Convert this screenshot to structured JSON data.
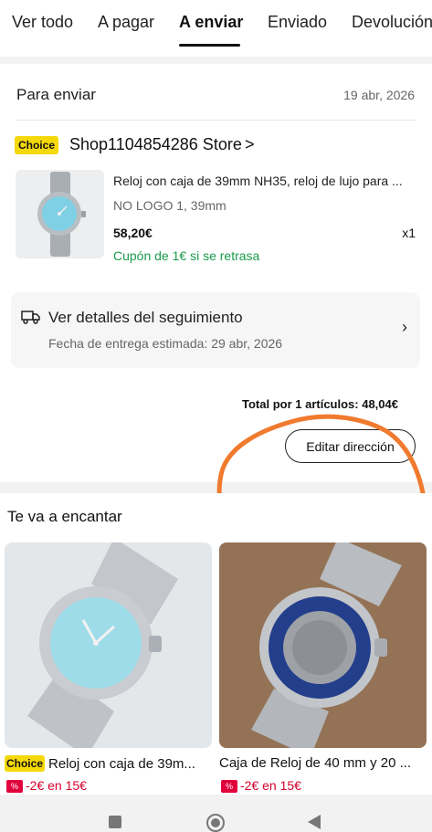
{
  "tabs": [
    {
      "label": "Ver todo"
    },
    {
      "label": "A pagar"
    },
    {
      "label": "A enviar"
    },
    {
      "label": "Enviado"
    },
    {
      "label": "Devolución/"
    }
  ],
  "order": {
    "section_title": "Para enviar",
    "date": "19 abr, 2026",
    "store": {
      "badge": "Choice",
      "name": "Shop1104854286 Store",
      "chevron": ">"
    },
    "product": {
      "title": "Reloj con caja de 39mm NH35, reloj de lujo para ...",
      "variant": "NO LOGO 1, 39mm",
      "price": "58,20€",
      "quantity": "x1",
      "coupon": "Cupón de 1€ si se retrasa"
    },
    "tracking": {
      "title": "Ver detalles del seguimiento",
      "eta": "Fecha de entrega estimada: 29 abr, 2026",
      "chevron": "›"
    },
    "total": "Total por 1 artículos: 48,04€",
    "edit_address_label": "Editar dirección"
  },
  "recommendations": {
    "title": "Te va a encantar",
    "items": [
      {
        "badge": "Choice",
        "title": "Reloj con caja de 39m...",
        "pct": "%",
        "discount": "-2€ en 15€"
      },
      {
        "badge": "",
        "title": "Caja de Reloj de 40 mm y 20 ...",
        "pct": "%",
        "discount": "-2€ en 15€"
      }
    ]
  },
  "colors": {
    "choice_yellow": "#f5d80a",
    "coupon_green": "#1a9a4b",
    "discount_red": "#d4002a",
    "annotation_orange": "#f07a2e"
  }
}
